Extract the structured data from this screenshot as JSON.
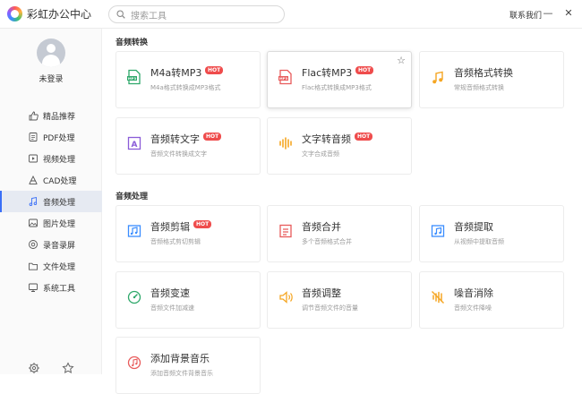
{
  "app": {
    "title": "彩虹办公中心",
    "contact": "联系我们"
  },
  "search": {
    "placeholder": "搜索工具"
  },
  "window_controls": {
    "minimize": "—",
    "close": "✕"
  },
  "user": {
    "login_label": "未登录"
  },
  "sidebar": {
    "items": [
      {
        "label": "精品推荐",
        "icon": "thumbs-up-icon",
        "active": false
      },
      {
        "label": "PDF处理",
        "icon": "pdf-icon",
        "active": false
      },
      {
        "label": "视频处理",
        "icon": "video-icon",
        "active": false
      },
      {
        "label": "CAD处理",
        "icon": "cad-icon",
        "active": false
      },
      {
        "label": "音频处理",
        "icon": "music-note-icon",
        "active": true
      },
      {
        "label": "图片处理",
        "icon": "image-icon",
        "active": false
      },
      {
        "label": "录音录屏",
        "icon": "record-icon",
        "active": false
      },
      {
        "label": "文件处理",
        "icon": "folder-icon",
        "active": false
      },
      {
        "label": "系统工具",
        "icon": "system-icon",
        "active": false
      }
    ],
    "bottom": [
      "settings-icon",
      "star-icon"
    ]
  },
  "sections": [
    {
      "title": "音频转换",
      "cards": [
        {
          "title": "M4a转MP3",
          "desc": "M4a格式转换成MP3格式",
          "hot": "HOT",
          "icon": "mp3-file-icon",
          "color": "#2ea86a"
        },
        {
          "title": "Flac转MP3",
          "desc": "Flac格式转换成MP3格式",
          "hot": "HOT",
          "icon": "mp3-file-icon",
          "color": "#e85b5b",
          "starred": "☆"
        },
        {
          "title": "音频格式转换",
          "desc": "常规音频格式转换",
          "hot": "",
          "icon": "music-file-icon",
          "color": "#f5a623"
        },
        {
          "title": "音频转文字",
          "desc": "音频文件转换成文字",
          "hot": "HOT",
          "icon": "audio-to-text-icon",
          "color": "#8a5cd8"
        },
        {
          "title": "文字转音频",
          "desc": "文字合成音频",
          "hot": "HOT",
          "icon": "text-to-audio-icon",
          "color": "#f5a623"
        }
      ]
    },
    {
      "title": "音频处理",
      "cards": [
        {
          "title": "音频剪辑",
          "desc": "音频格式剪切剪辑",
          "hot": "HOT",
          "icon": "audio-cut-icon",
          "color": "#3a8dff"
        },
        {
          "title": "音频合并",
          "desc": "多个音频格式合并",
          "hot": "",
          "icon": "audio-merge-icon",
          "color": "#e85b5b"
        },
        {
          "title": "音频提取",
          "desc": "从视频中提取音频",
          "hot": "",
          "icon": "audio-extract-icon",
          "color": "#3a8dff"
        },
        {
          "title": "音频变速",
          "desc": "音频文件加减速",
          "hot": "",
          "icon": "speed-icon",
          "color": "#2ea86a"
        },
        {
          "title": "音频调整",
          "desc": "调节音频文件的音量",
          "hot": "",
          "icon": "volume-icon",
          "color": "#f5a623"
        },
        {
          "title": "噪音消除",
          "desc": "音频文件降噪",
          "hot": "",
          "icon": "noise-cancel-icon",
          "color": "#f5a623"
        },
        {
          "title": "添加背景音乐",
          "desc": "添加音频文件背景音乐",
          "hot": "",
          "icon": "bg-music-icon",
          "color": "#e85b5b"
        }
      ]
    }
  ]
}
